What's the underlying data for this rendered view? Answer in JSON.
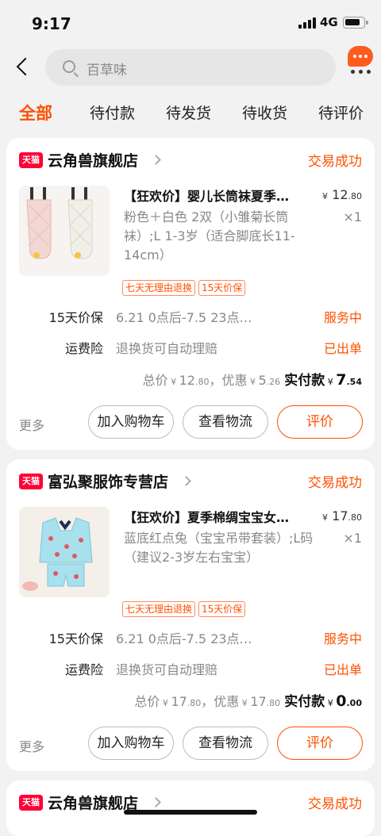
{
  "status_bar": {
    "time": "9:17",
    "network": "4G"
  },
  "search": {
    "placeholder": "百草味"
  },
  "tabs": [
    "全部",
    "待付款",
    "待发货",
    "待收货",
    "待评价"
  ],
  "orders": [
    {
      "store_badge": "天猫",
      "store": "云角兽旗舰店",
      "status": "交易成功",
      "title": "【狂欢价】婴儿长筒袜夏季…",
      "price_symbol": "¥",
      "price_int": "12",
      "price_dec": ".80",
      "spec": "粉色＋白色 2双（小雏菊长筒袜）;L 1-3岁（适合脚底长11-14cm）",
      "qty": "×1",
      "tags": [
        "七天无理由退换",
        "15天价保"
      ],
      "services": [
        {
          "label": "15天价保",
          "desc": "6.21 0点后-7.5 23点…",
          "state": "服务中"
        },
        {
          "label": "运费险",
          "desc": "退换货可自动理赔",
          "state": "已出单"
        }
      ],
      "totals": {
        "total_label": "总价",
        "total_int": "12",
        "total_dec": ".80",
        "discount_label": "，优惠",
        "discount_int": "5",
        "discount_dec": ".26",
        "paid_label": "实付款",
        "paid_int": "7",
        "paid_dec": ".54"
      },
      "more": "更多",
      "buttons": [
        "加入购物车",
        "查看物流",
        "评价"
      ]
    },
    {
      "store_badge": "天猫",
      "store": "富弘聚服饰专营店",
      "status": "交易成功",
      "title": "【狂欢价】夏季棉绸宝宝女…",
      "price_symbol": "¥",
      "price_int": "17",
      "price_dec": ".80",
      "spec": "蓝底红点兔（宝宝吊带套装）;L码（建议2-3岁左右宝宝）",
      "qty": "×1",
      "tags": [
        "七天无理由退换",
        "15天价保"
      ],
      "services": [
        {
          "label": "15天价保",
          "desc": "6.21 0点后-7.5 23点…",
          "state": "服务中"
        },
        {
          "label": "运费险",
          "desc": "退换货可自动理赔",
          "state": "已出单"
        }
      ],
      "totals": {
        "total_label": "总价",
        "total_int": "17",
        "total_dec": ".80",
        "discount_label": "，优惠",
        "discount_int": "17",
        "discount_dec": ".80",
        "paid_label": "实付款",
        "paid_int": "0",
        "paid_dec": ".00"
      },
      "more": "更多",
      "buttons": [
        "加入购物车",
        "查看物流",
        "评价"
      ]
    },
    {
      "store_badge": "天猫",
      "store": "云角兽旗舰店",
      "status": "交易成功"
    }
  ],
  "colors": {
    "accent": "#ff5000",
    "tmall": "#ff0036"
  }
}
